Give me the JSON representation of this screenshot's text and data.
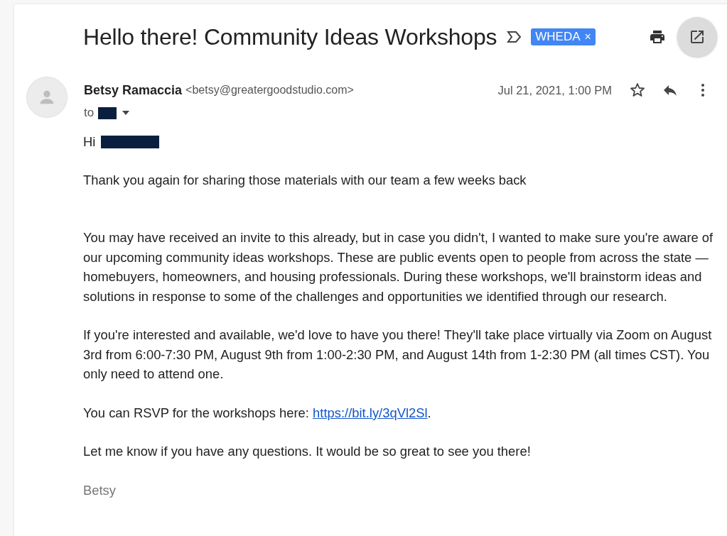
{
  "subject": "Hello there! Community Ideas Workshops",
  "label": {
    "text": "WHEDA",
    "remove": "×",
    "color": "#4285f4"
  },
  "sender": {
    "name": "Betsy Ramaccia",
    "email": "<betsy@greatergoodstudio.com>",
    "date": "Jul 21, 2021, 1:00 PM",
    "starred": false
  },
  "recipient": {
    "prefix": "to",
    "redacted": true
  },
  "greeting": {
    "word": "Hi",
    "redacted": true
  },
  "paragraphs": [
    {
      "kind": "text",
      "text": "Thank you again for sharing those materials with our team a few weeks back"
    },
    {
      "kind": "text",
      "text": "You may have received an invite to this already, but in case you didn't, I wanted to make sure you're aware of our upcoming community ideas workshops. These are public events open to people from across the state — homebuyers, homeowners, and housing professionals. During these workshops, we'll brainstorm ideas and solutions in response to some of the challenges and opportunities we identified through our research."
    },
    {
      "kind": "text",
      "text": "If you're interested and available, we'd love to have you there! They'll take place virtually via Zoom on August 3rd from 6:00-7:30 PM, August 9th from 1:00-2:30 PM, and August 14th from 1-2:30 PM (all times CST). You only need to attend one."
    },
    {
      "kind": "link",
      "before": "You can RSVP for the workshops here: ",
      "link": "https://bit.ly/3qVl2Sl",
      "after": "."
    },
    {
      "kind": "text",
      "text": "Let me know if you have any questions. It would be so great to see you there!"
    },
    {
      "kind": "signature",
      "text": "Betsy"
    }
  ]
}
